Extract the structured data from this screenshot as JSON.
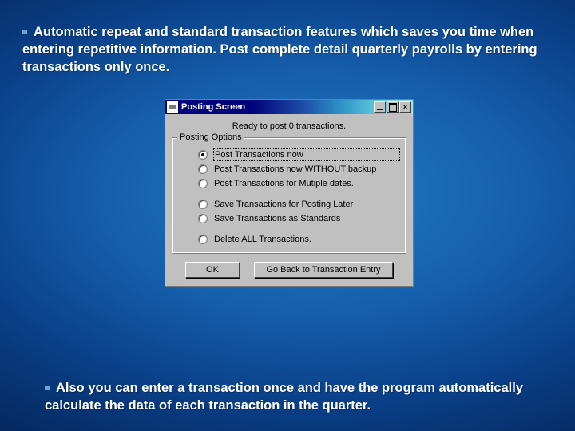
{
  "slide": {
    "heading": "Automatic repeat and standard transaction features which saves you time when entering repetitive information.  Post complete detail quarterly payrolls by entering transactions only once.",
    "footer": "Also you can enter a transaction once and have the program automatically calculate the data of each transaction in the quarter."
  },
  "window": {
    "title": "Posting Screen",
    "ready_line": "Ready to post  0 transactions.",
    "group_legend": "Posting Options",
    "options": [
      {
        "label": "Post Transactions now",
        "checked": true
      },
      {
        "label": "Post Transactions now WITHOUT backup",
        "checked": false
      },
      {
        "label": "Post Transactions for Mutiple dates.",
        "checked": false
      },
      {
        "label": "Save Transactions for Posting Later",
        "checked": false
      },
      {
        "label": "Save Transactions as Standards",
        "checked": false
      },
      {
        "label": "Delete ALL Transactions.",
        "checked": false
      }
    ],
    "buttons": {
      "ok": "OK",
      "back": "Go Back to Transaction Entry"
    }
  }
}
